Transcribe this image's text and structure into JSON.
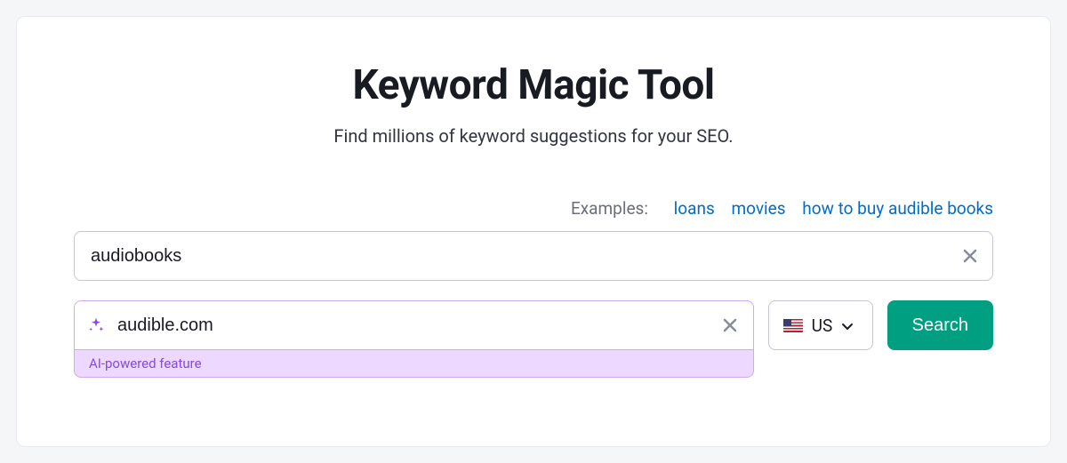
{
  "header": {
    "title": "Keyword Magic Tool",
    "subtitle": "Find millions of keyword suggestions for your SEO."
  },
  "examples": {
    "label": "Examples:",
    "links": [
      "loans",
      "movies",
      "how to buy audible books"
    ]
  },
  "keyword_input": {
    "value": "audiobooks"
  },
  "domain_input": {
    "value": "audible.com",
    "ai_badge": "AI-powered feature"
  },
  "country": {
    "code": "US"
  },
  "search_button": {
    "label": "Search"
  }
}
